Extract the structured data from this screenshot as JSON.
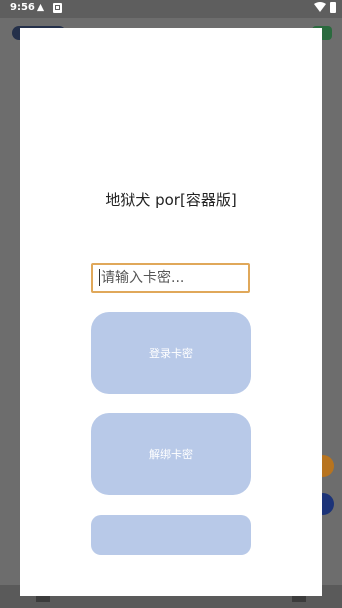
{
  "status_bar": {
    "time": "9:56",
    "icons": [
      "notification-icon",
      "sim-icon",
      "wifi-icon",
      "battery-icon"
    ]
  },
  "dialog": {
    "title": "地狱犬 por[容器版]",
    "card_input": {
      "value": "",
      "placeholder": "请输入卡密..."
    },
    "buttons": {
      "login": "登录卡密",
      "unbind": "解绑卡密"
    }
  },
  "colors": {
    "button_bg": "#b8c9e8",
    "input_border": "#e0a85a",
    "overlay": "#6d6d6d"
  }
}
